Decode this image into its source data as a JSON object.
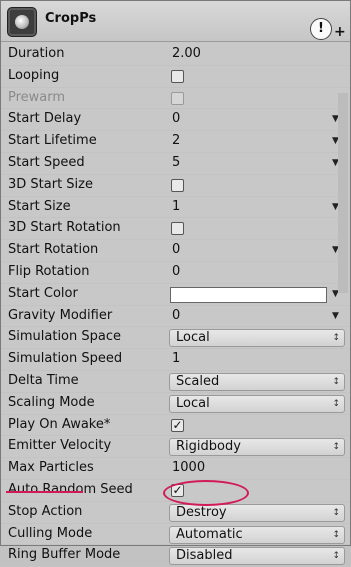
{
  "header": {
    "title": "CropPs"
  },
  "rows": [
    {
      "label": "Duration",
      "type": "text",
      "value": "2.00"
    },
    {
      "label": "Looping",
      "type": "checkbox",
      "checked": false
    },
    {
      "label": "Prewarm",
      "type": "checkbox",
      "checked": false,
      "disabled": true
    },
    {
      "label": "Start Delay",
      "type": "curve",
      "value": "0"
    },
    {
      "label": "Start Lifetime",
      "type": "curve",
      "value": "2"
    },
    {
      "label": "Start Speed",
      "type": "curve",
      "value": "5"
    },
    {
      "label": "3D Start Size",
      "type": "checkbox",
      "checked": false
    },
    {
      "label": "Start Size",
      "type": "curve",
      "value": "1"
    },
    {
      "label": "3D Start Rotation",
      "type": "checkbox",
      "checked": false
    },
    {
      "label": "Start Rotation",
      "type": "curve",
      "value": "0"
    },
    {
      "label": "Flip Rotation",
      "type": "text",
      "value": "0"
    },
    {
      "label": "Start Color",
      "type": "color",
      "value": "#ffffff"
    },
    {
      "label": "Gravity Modifier",
      "type": "curve",
      "value": "0"
    },
    {
      "label": "Simulation Space",
      "type": "dropdown",
      "value": "Local"
    },
    {
      "label": "Simulation Speed",
      "type": "text",
      "value": "1"
    },
    {
      "label": "Delta Time",
      "type": "dropdown",
      "value": "Scaled"
    },
    {
      "label": "Scaling Mode",
      "type": "dropdown",
      "value": "Local"
    },
    {
      "label": "Play On Awake*",
      "type": "checkbox",
      "checked": true
    },
    {
      "label": "Emitter Velocity",
      "type": "dropdown",
      "value": "Rigidbody"
    },
    {
      "label": "Max Particles",
      "type": "text",
      "value": "1000"
    },
    {
      "label": "Auto Random Seed",
      "type": "checkbox",
      "checked": true
    },
    {
      "label": "Stop Action",
      "type": "dropdown",
      "value": "Destroy"
    },
    {
      "label": "Culling Mode",
      "type": "dropdown",
      "value": "Automatic"
    },
    {
      "label": "Ring Buffer Mode",
      "type": "dropdown",
      "value": "Disabled"
    }
  ],
  "icons": {
    "warning": "warning-icon",
    "add": "plus-icon"
  },
  "colors": {
    "annotation": "#d11a5a"
  }
}
